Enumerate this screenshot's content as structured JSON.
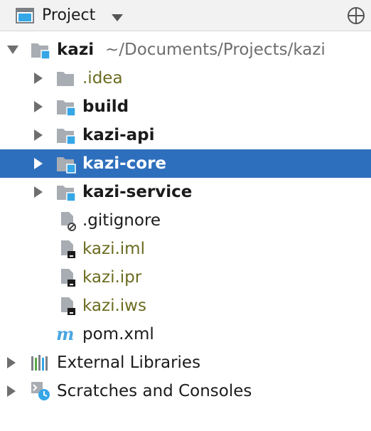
{
  "header": {
    "title": "Project",
    "icon": "project-window-icon",
    "dropdown_icon": "chevron-down-icon",
    "action_icon": "crosshair-icon"
  },
  "tree": {
    "root": {
      "name": "kazi",
      "path": "~/Documents/Projects/kazi",
      "icon": "module-folder-icon",
      "expanded": true
    },
    "items": [
      {
        "label": ".idea",
        "icon": "folder-icon",
        "color": "#6b6b20"
      },
      {
        "label": "build",
        "icon": "module-folder-icon",
        "color": "#1b1b1b"
      },
      {
        "label": "kazi-api",
        "icon": "module-folder-icon",
        "color": "#1b1b1b"
      },
      {
        "label": "kazi-core",
        "icon": "module-folder-icon",
        "color": "#ffffff",
        "selected": true
      },
      {
        "label": "kazi-service",
        "icon": "module-folder-icon",
        "color": "#1b1b1b"
      },
      {
        "label": ".gitignore",
        "icon": "ignored-file-icon",
        "color": "#1b1b1b"
      },
      {
        "label": "kazi.iml",
        "icon": "file-icon",
        "color": "#6b6b20"
      },
      {
        "label": "kazi.ipr",
        "icon": "file-icon",
        "color": "#6b6b20"
      },
      {
        "label": "kazi.iws",
        "icon": "file-icon",
        "color": "#6b6b20"
      },
      {
        "label": "pom.xml",
        "icon": "maven-icon",
        "color": "#1b1b1b"
      }
    ],
    "bottom": [
      {
        "label": "External Libraries",
        "icon": "libraries-icon"
      },
      {
        "label": "Scratches and Consoles",
        "icon": "scratches-icon"
      }
    ]
  },
  "colors": {
    "selection": "#2e6fbd",
    "folder": "#a8adb3",
    "module_badge": "#35a6e6",
    "olive_text": "#6b6b20"
  }
}
